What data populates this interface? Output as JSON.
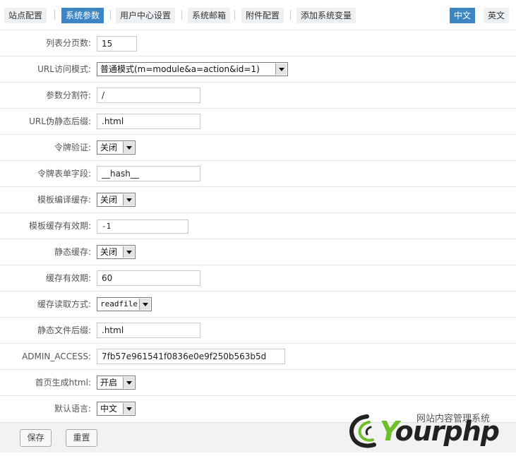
{
  "tabs": [
    "站点配置",
    "系统参数",
    "用户中心设置",
    "系统邮箱",
    "附件配置",
    "添加系统变量"
  ],
  "langs": [
    "中文",
    "英文"
  ],
  "fields": {
    "page_size": {
      "label": "列表分页数:",
      "value": "15"
    },
    "url_mode": {
      "label": "URL访问模式:",
      "value": "普通模式(m=module&a=action&id=1)"
    },
    "separator": {
      "label": "参数分割符:",
      "value": "/"
    },
    "suffix": {
      "label": "URL伪静态后缀:",
      "value": ".html"
    },
    "token": {
      "label": "令牌验证:",
      "value": "关闭"
    },
    "token_field": {
      "label": "令牌表单字段:",
      "value": "__hash__"
    },
    "tpl_cache": {
      "label": "模板编译缓存:",
      "value": "关闭"
    },
    "tpl_cache_time": {
      "label": "模板缓存有效期:",
      "value": "-1"
    },
    "static_cache": {
      "label": "静态缓存:",
      "value": "关闭"
    },
    "cache_time": {
      "label": "缓存有效期:",
      "value": "60"
    },
    "cache_read": {
      "label": "缓存读取方式:",
      "value": "readfile"
    },
    "static_suffix": {
      "label": "静态文件后缀:",
      "value": ".html"
    },
    "admin_access": {
      "label": "ADMIN_ACCESS:",
      "value": "7fb57e961541f0836e0e9f250b563b5d"
    },
    "home_html": {
      "label": "首页生成html:",
      "value": "开启"
    },
    "default_lang": {
      "label": "默认语言:",
      "value": "中文"
    }
  },
  "buttons": {
    "save": "保存",
    "reset": "重置"
  },
  "logo": {
    "name_cn": "网站内容管理系统",
    "name_en_y": "Y",
    "name_en_rest": "ourphp"
  }
}
